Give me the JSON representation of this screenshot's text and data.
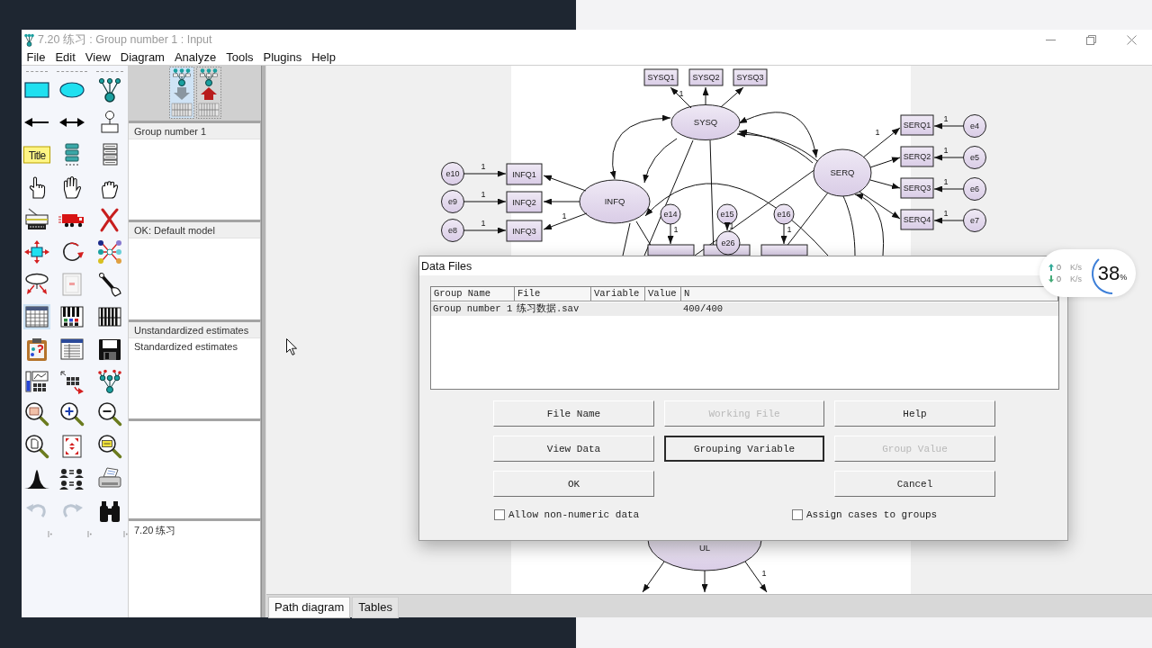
{
  "window": {
    "title": "7.20 练习 : Group number 1 : Input"
  },
  "menu": [
    "File",
    "Edit",
    "View",
    "Diagram",
    "Analyze",
    "Tools",
    "Plugins",
    "Help"
  ],
  "toolbar": [
    {
      "kind": "rect",
      "selected": false,
      "disabled": false
    },
    {
      "kind": "ellipse",
      "selected": false,
      "disabled": false
    },
    {
      "kind": "tree",
      "selected": false,
      "disabled": false
    },
    {
      "kind": "arrow",
      "selected": false,
      "disabled": false
    },
    {
      "kind": "biarrow",
      "selected": false,
      "disabled": false
    },
    {
      "kind": "pin",
      "selected": false,
      "disabled": false
    },
    {
      "kind": "title",
      "label": "Title",
      "selected": false,
      "disabled": false
    },
    {
      "kind": "bars",
      "selected": false,
      "disabled": false
    },
    {
      "kind": "boxes",
      "selected": false,
      "disabled": false
    },
    {
      "kind": "point",
      "selected": false,
      "disabled": false
    },
    {
      "kind": "palm",
      "selected": false,
      "disabled": false
    },
    {
      "kind": "fist",
      "selected": false,
      "disabled": false
    },
    {
      "kind": "copier",
      "selected": false,
      "disabled": false
    },
    {
      "kind": "truck",
      "selected": false,
      "disabled": false
    },
    {
      "kind": "cross",
      "selected": false,
      "disabled": false
    },
    {
      "kind": "resize",
      "selected": false,
      "disabled": false
    },
    {
      "kind": "rotate",
      "selected": false,
      "disabled": false
    },
    {
      "kind": "network",
      "selected": false,
      "disabled": false
    },
    {
      "kind": "orbit",
      "selected": false,
      "disabled": false
    },
    {
      "kind": "page",
      "selected": false,
      "disabled": false
    },
    {
      "kind": "wand",
      "selected": false,
      "disabled": false
    },
    {
      "kind": "table",
      "selected": true,
      "disabled": false
    },
    {
      "kind": "keygrid",
      "selected": false,
      "disabled": false
    },
    {
      "kind": "keys",
      "selected": false,
      "disabled": false
    },
    {
      "kind": "clipboard",
      "selected": false,
      "disabled": false
    },
    {
      "kind": "window",
      "selected": false,
      "disabled": false
    },
    {
      "kind": "floppy",
      "selected": false,
      "disabled": false
    },
    {
      "kind": "gauge",
      "selected": false,
      "disabled": false
    },
    {
      "kind": "drag",
      "selected": false,
      "disabled": false
    },
    {
      "kind": "branch",
      "selected": false,
      "disabled": false
    },
    {
      "kind": "zoompic",
      "selected": false,
      "disabled": false
    },
    {
      "kind": "zoomin",
      "selected": false,
      "disabled": false
    },
    {
      "kind": "zoomout",
      "selected": false,
      "disabled": false
    },
    {
      "kind": "zoompage",
      "selected": false,
      "disabled": false
    },
    {
      "kind": "fit",
      "selected": false,
      "disabled": false
    },
    {
      "kind": "zoomscreen",
      "selected": false,
      "disabled": false
    },
    {
      "kind": "bell",
      "selected": false,
      "disabled": false
    },
    {
      "kind": "people",
      "selected": false,
      "disabled": false
    },
    {
      "kind": "printer",
      "selected": false,
      "disabled": false
    },
    {
      "kind": "undo",
      "selected": false,
      "disabled": true
    },
    {
      "kind": "redo",
      "selected": false,
      "disabled": true
    },
    {
      "kind": "binoculars",
      "selected": false,
      "disabled": false
    }
  ],
  "view_buttons": [
    {
      "kind": "input",
      "selected": true
    },
    {
      "kind": "output",
      "selected": false
    }
  ],
  "groups": [
    {
      "label": "Group number 1",
      "selected": true
    }
  ],
  "models": [
    {
      "label": "OK: Default model",
      "selected": true
    }
  ],
  "estimates": [
    {
      "label": "Unstandardized estimates",
      "selected": true
    },
    {
      "label": "Standardized estimates",
      "selected": false
    }
  ],
  "files": [
    {
      "label": "7.20 练习",
      "selected": false
    }
  ],
  "diagram": {
    "latent_variables": [
      "SYSQ",
      "SERQ",
      "INFQ",
      "UL"
    ],
    "observed_variables": [
      "SYSQ1",
      "SYSQ2",
      "SYSQ3",
      "SERQ1",
      "SERQ2",
      "SERQ3",
      "SERQ4",
      "INFQ1",
      "INFQ2",
      "INFQ3"
    ],
    "error_terms": [
      "e4",
      "e5",
      "e6",
      "e7",
      "e10",
      "e9",
      "e8",
      "e14",
      "e15",
      "e16",
      "e26"
    ],
    "path_labels": [
      "1",
      "1",
      "1",
      "1",
      "1",
      "1",
      "1",
      "1",
      "1",
      "1",
      "1",
      "1",
      "1",
      "1"
    ]
  },
  "tabs": [
    {
      "label": "Path diagram",
      "selected": true
    },
    {
      "label": "Tables",
      "selected": false
    }
  ],
  "data_files_dialog": {
    "title": "Data Files",
    "columns": [
      "Group Name",
      "File",
      "Variable",
      "Value",
      "N"
    ],
    "rows": [
      {
        "group_name": "Group number 1",
        "file": "练习数据.sav",
        "n": "400/400",
        "selected": true
      }
    ],
    "buttons": [
      {
        "label": "File Name",
        "disabled": false,
        "focused": false
      },
      {
        "label": "Working File",
        "disabled": true,
        "focused": false
      },
      {
        "label": "Help",
        "disabled": false,
        "focused": false
      },
      {
        "label": "View Data",
        "disabled": false,
        "focused": false
      },
      {
        "label": "Grouping Variable",
        "disabled": false,
        "focused": true
      },
      {
        "label": "Group Value",
        "disabled": true,
        "focused": false
      },
      {
        "label": "OK",
        "disabled": false,
        "focused": false
      },
      {
        "label": "Cancel",
        "disabled": false,
        "focused": false
      }
    ],
    "checkboxes": [
      {
        "label": "Allow non-numeric data",
        "checked": false
      },
      {
        "label": "Assign cases to groups",
        "checked": false
      }
    ]
  },
  "speed_widget": {
    "rates": [
      {
        "kind": "upload",
        "value": "0",
        "unit": "K/s"
      },
      {
        "kind": "download",
        "value": "0",
        "unit": "K/s"
      }
    ],
    "percent": "38",
    "percent_sign": "%",
    "level": 0.38
  }
}
